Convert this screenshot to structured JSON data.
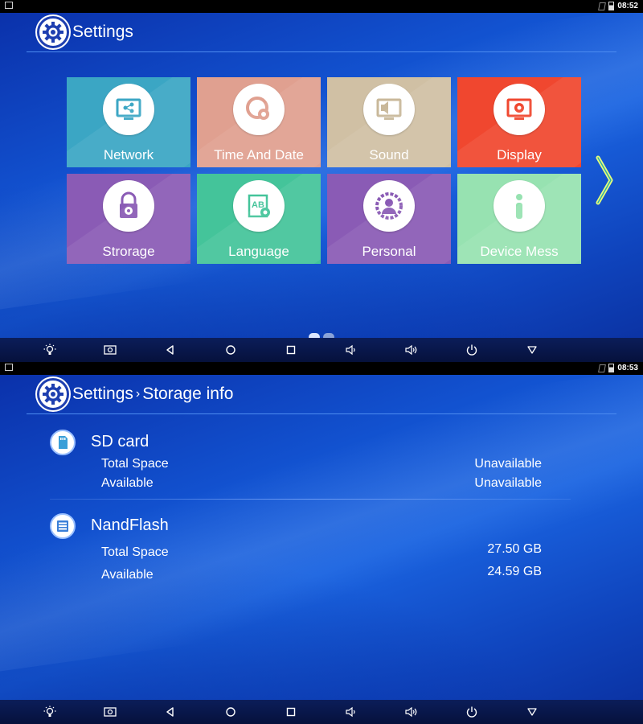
{
  "screen1": {
    "status_time": "08:52",
    "title": "Settings",
    "tiles": [
      {
        "label": "Network",
        "icon": "network-monitor-icon",
        "color": "#3ba6c4"
      },
      {
        "label": "Time And Date",
        "icon": "clock-gear-icon",
        "color": "#e0a090"
      },
      {
        "label": "Sound",
        "icon": "speaker-monitor-icon",
        "color": "#d0c0a4"
      },
      {
        "label": "Display",
        "icon": "display-gear-icon",
        "color": "#f0472f"
      },
      {
        "label": "Strorage",
        "icon": "padlock-gear-icon",
        "color": "#8a5bb5"
      },
      {
        "label": "Language",
        "icon": "ab-language-icon",
        "color": "#44c49a"
      },
      {
        "label": "Personal",
        "icon": "person-gear-icon",
        "color": "#8a5bb5"
      },
      {
        "label": "Device Mess",
        "icon": "info-icon",
        "color": "#97e2b1"
      }
    ],
    "pager": {
      "pages": 2,
      "current": 1
    }
  },
  "screen2": {
    "status_time": "08:53",
    "breadcrumb": {
      "root": "Settings",
      "separator": "›",
      "current": "Storage info"
    },
    "sections": [
      {
        "title": "SD card",
        "icon": "sd-card-icon",
        "rows": [
          {
            "label": "Total Space",
            "value": "Unavailable"
          },
          {
            "label": "Available",
            "value": "Unavailable"
          }
        ]
      },
      {
        "title": "NandFlash",
        "icon": "storage-list-icon",
        "rows": [
          {
            "label": "Total Space",
            "value": "27.50 GB"
          },
          {
            "label": "Available",
            "value": "24.59 GB"
          }
        ]
      }
    ]
  },
  "navbar_buttons": [
    "brightness-icon",
    "screenshot-icon",
    "back-icon",
    "home-icon",
    "recents-icon",
    "volume-down-icon",
    "volume-up-icon",
    "power-icon",
    "hide-bar-icon"
  ]
}
